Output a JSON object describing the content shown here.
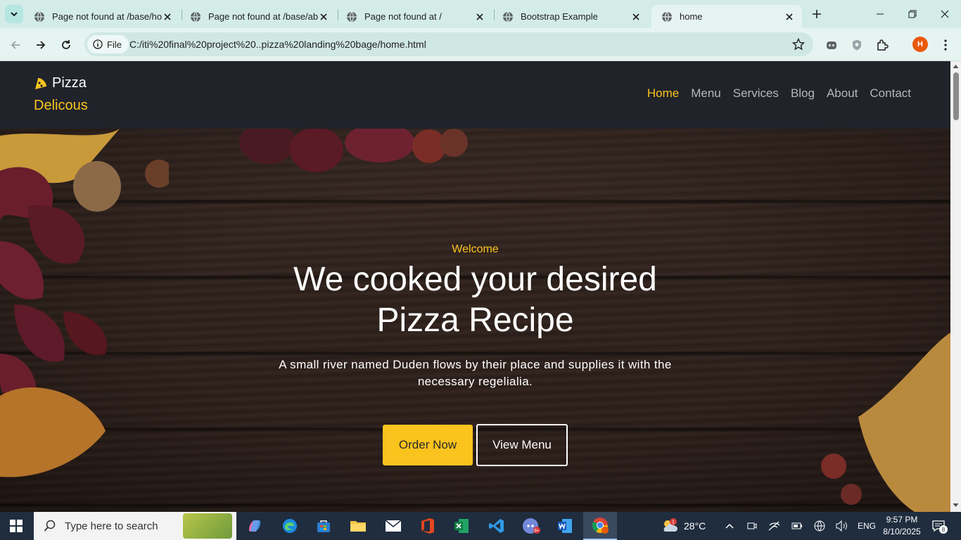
{
  "browser": {
    "tabs": [
      {
        "title": "Page not found at /base/home",
        "active": false
      },
      {
        "title": "Page not found at /base/about",
        "active": false
      },
      {
        "title": "Page not found at /",
        "active": false
      },
      {
        "title": "Bootstrap Example",
        "active": false
      },
      {
        "title": "home",
        "active": true
      }
    ],
    "chip_label": "File",
    "url": "C:/iti%20final%20project%20..pizza%20landing%20bage/home.html",
    "profile_initial": "H"
  },
  "site": {
    "brand_line1": "Pizza",
    "brand_line2": "Delicous",
    "nav": [
      {
        "label": "Home",
        "active": true
      },
      {
        "label": "Menu",
        "active": false
      },
      {
        "label": "Services",
        "active": false
      },
      {
        "label": "Blog",
        "active": false
      },
      {
        "label": "About",
        "active": false
      },
      {
        "label": "Contact",
        "active": false
      }
    ],
    "hero": {
      "welcome": "Welcome",
      "headline_line1": "We cooked your desired",
      "headline_line2": "Pizza Recipe",
      "subtext": "A small river named Duden flows by their place and supplies it with the necessary regelialia.",
      "order_button": "Order Now",
      "menu_button": "View Menu"
    },
    "colors": {
      "accent": "#fac31e",
      "nav_bg": "#20232a"
    }
  },
  "taskbar": {
    "search_placeholder": "Type here to search",
    "weather_temp": "28°C",
    "weather_badge": "1",
    "language": "ENG",
    "time": "9:57 PM",
    "date": "8/10/2025",
    "notification_count": "8",
    "discord_badge": "9+"
  }
}
